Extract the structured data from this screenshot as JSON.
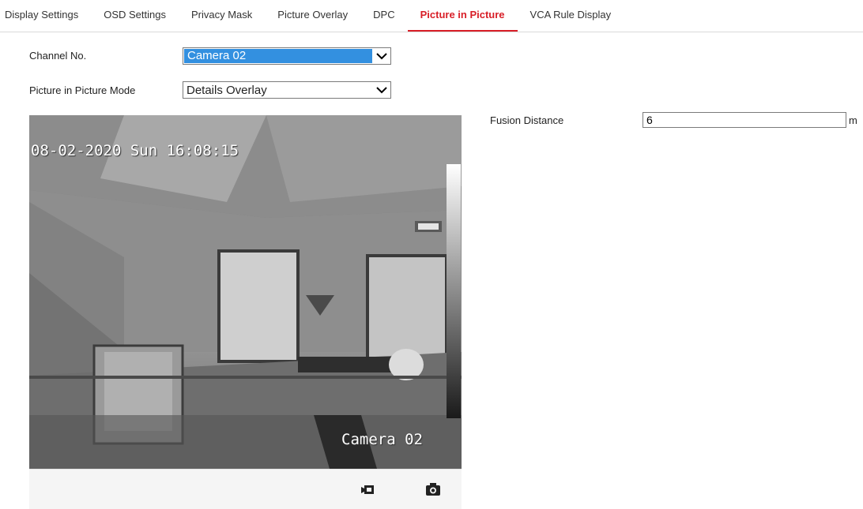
{
  "tabs": [
    {
      "label": "Display Settings",
      "active": false
    },
    {
      "label": "OSD Settings",
      "active": false
    },
    {
      "label": "Privacy Mask",
      "active": false
    },
    {
      "label": "Picture Overlay",
      "active": false
    },
    {
      "label": "DPC",
      "active": false
    },
    {
      "label": "Picture in Picture",
      "active": true
    },
    {
      "label": "VCA Rule Display",
      "active": false
    }
  ],
  "form": {
    "channel_label": "Channel No.",
    "channel_value": "Camera 02",
    "pip_mode_label": "Picture in Picture Mode",
    "pip_mode_value": "Details Overlay",
    "fusion_label": "Fusion Distance",
    "fusion_value": "6",
    "fusion_unit": "m"
  },
  "video": {
    "timestamp": "08-02-2020 Sun 16:08:15",
    "camera_name": "Camera 02"
  },
  "icons": {
    "record": "record-video-icon",
    "capture": "camera-snapshot-icon",
    "dropdown": "chevron-down-icon"
  },
  "colors": {
    "accent": "#d81e27",
    "select_highlight": "#3390e0"
  }
}
